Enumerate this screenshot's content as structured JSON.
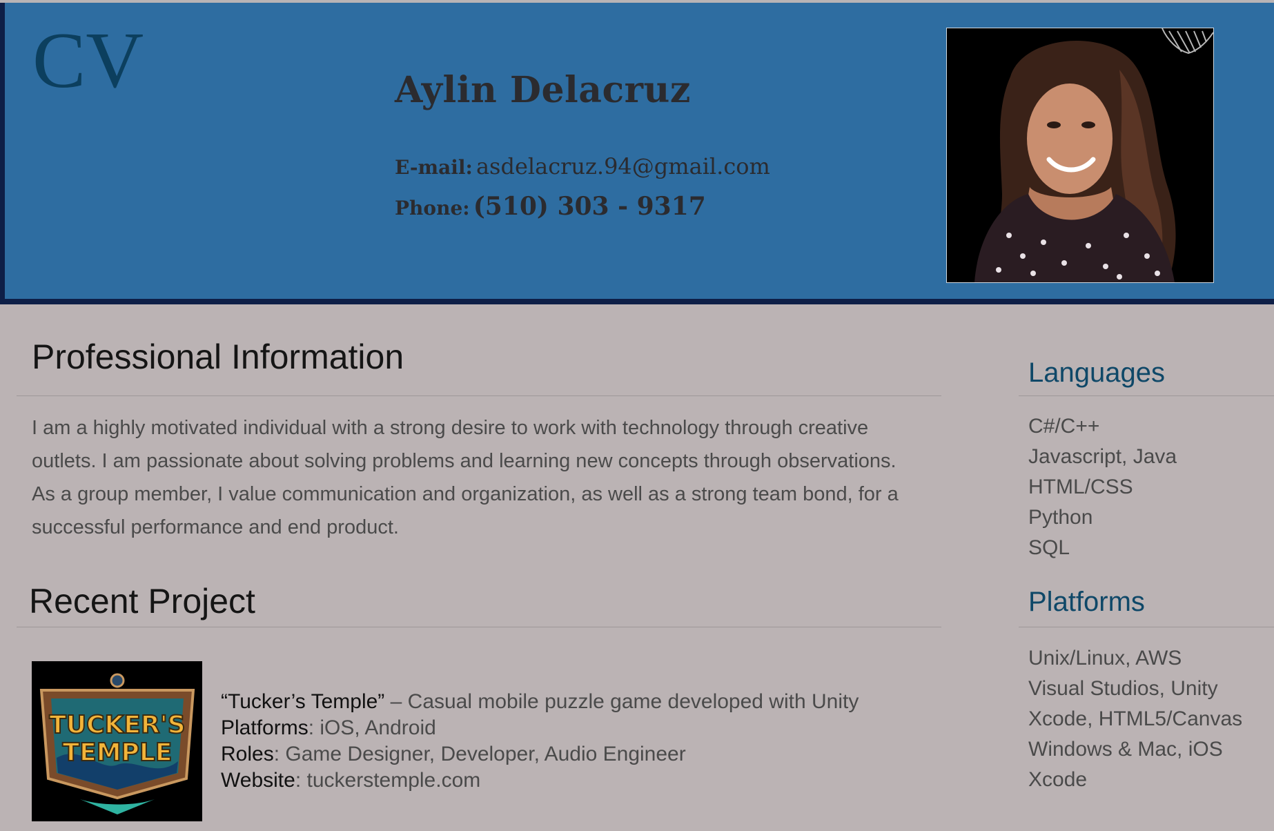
{
  "header": {
    "cv_mark": "CV",
    "name": "Aylin Delacruz",
    "email_label": "E-mail:",
    "email_value": "asdelacruz.94@gmail.com",
    "phone_label": "Phone:",
    "phone_value": "(510) 303 - 9317"
  },
  "professional": {
    "title": "Professional Information",
    "body": "I am a highly motivated individual with a strong desire to work with technology through creative outlets. I am passionate about solving problems and learning new concepts through observations. As a group member, I value communication and organization, as well as a strong team bond, for a successful performance and end product."
  },
  "recent_project": {
    "title": "Recent Project",
    "logo_text_line1": "TUCKER'S",
    "logo_text_line2": "TEMPLE",
    "name": "“Tucker’s Temple”",
    "description": " – Casual mobile puzzle game developed with Unity",
    "platforms_label": "Platforms",
    "platforms_value": ": iOS, Android",
    "roles_label": "Roles",
    "roles_value": ": Game Designer, Developer, Audio Engineer",
    "website_label": "Website",
    "website_value": ": tuckerstemple.com"
  },
  "sidebar": {
    "languages_title": "Languages",
    "languages": [
      "C#/C++",
      "Javascript, Java",
      "HTML/CSS",
      "Python",
      "SQL"
    ],
    "platforms_title": "Platforms",
    "platforms": [
      "Unix/Linux, AWS",
      "Visual Studios, Unity",
      "Xcode, HTML5/Canvas",
      "Windows & Mac, iOS",
      "Xcode"
    ]
  },
  "colors": {
    "header_bg": "#2e6da1",
    "header_border": "#0e1f47",
    "page_bg": "#bbb3b4",
    "cv_mark": "#0c3f5e",
    "sidebar_heading": "#0f4868"
  }
}
